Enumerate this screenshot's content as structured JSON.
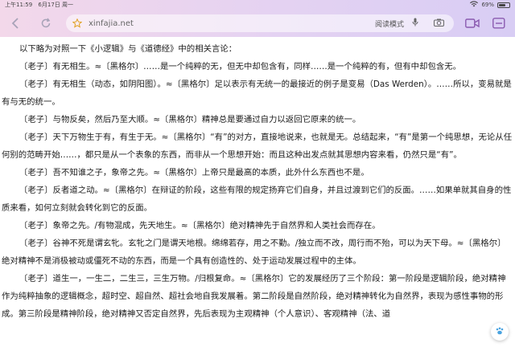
{
  "status": {
    "time": "上午11:59",
    "date": "6月17日 周一",
    "battery_text": "69%",
    "battery_level": 0.69
  },
  "toolbar": {
    "url": "xinfajia.net",
    "reader_mode": "阅读模式"
  },
  "article": {
    "intro": "以下略为对照一下《小逻辑》与《道德经》中的相关言论：",
    "paragraphs": [
      "〔老子〕有无相生。≈〔黑格尔〕……是一个纯粹的无，但无中却包含有，同样……是一个纯粹的有，但有中却包含无。",
      "〔老子〕有无相生（动态，如阴阳图）。≈〔黑格尔〕足以表示有无统一的最接近的例子是变易（Das Werden）。……所以，变易就是有与无的统一。",
      "〔老子〕与物反矣，然后乃至大顺。≈〔黑格尔〕精神总是要通过自力以返回它原来的统一。",
      "〔老子〕天下万物生于有，有生于无。≈〔黑格尔〕“有”的对方，直接地说来，也就是无。总结起来，“有”是第一个纯思想，无论从任何别的范畴开始……，都只是从一个表象的东西，而非从一个思想开始：而且这种出发点就其思想内容来看，仍然只是“有”。",
      "〔老子〕吾不知谁之子，象帝之先。≈〔黑格尔〕上帝只是最高的本质，此外什么东西也不是。",
      "〔老子〕反者道之动。≈〔黑格尔〕在辩证的阶段，这些有限的规定扬弃它们自身，并且过渡到它们的反面。……如果单就其自身的性质来看，如何立刻就会转化到它的反面。",
      "〔老子〕象帝之先。/有物混成，先天地生。≈〔黑格尔〕绝对精神先于自然界和人类社会而存在。",
      "〔老子〕谷神不死是谓玄牝。玄牝之门是谓天地根。绵绵若存，用之不勤。/独立而不改，周行而不殆，可以为天下母。≈〔黑格尔〕绝对精神不是消极被动或僵死不动的东西，而是一个具有创造性的、处于运动发展过程中的主体。",
      "〔老子〕道生一，一生二，二生三，三生万物。/归根复命。≈〔黑格尔〕它的发展经历了三个阶段：第一阶段是逻辑阶段，绝对精神作为纯粹抽象的逻辑概念，超时空、超自然、超社会地自我发展着。第二阶段是自然阶段，绝对精神转化为自然界，表现为感性事物的形成。第三阶段是精神阶段，绝对精神又否定自然界，先后表现为主观精神（个人意识）、客观精神（法、道"
    ]
  }
}
